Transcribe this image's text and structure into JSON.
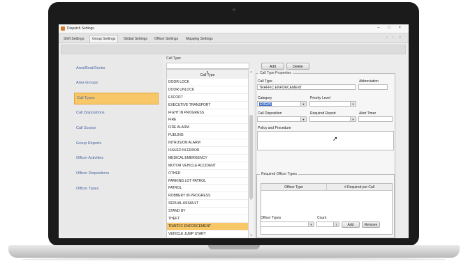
{
  "window": {
    "title": "Dispatch Settings",
    "controls": "–  □  ×"
  },
  "tabs": [
    "Shift Settings",
    "Group Settings",
    "Global Settings",
    "Officer Settings",
    "Mapping Settings"
  ],
  "tab_nav": "‹  ›  ×",
  "sidebar": {
    "items": [
      "Area/Beat/Sector",
      "Area Groups",
      "Call Types",
      "Call Dispositions",
      "Call Source",
      "Group Reports",
      "Officer Activities",
      "Officer Dispositions",
      "Officer Types"
    ],
    "selected": "Call Types"
  },
  "call_type_list": {
    "caption": "Call Type",
    "header": "Call Type",
    "sort_glyph": "▲",
    "items": [
      "DOOR LOCK",
      "DOOR UNLOCK",
      "ESCORT",
      "EXECUTIVE TRANSPORT",
      "FIGHT IN PROGRESS",
      "FIRE",
      "FIRE ALARM",
      "FUELING",
      "INTRUSION ALARM",
      "ISSUED IN ERROR",
      "MEDICAL EMERGENCY",
      "MOTOR VEHICLE ACCIDENT",
      "OTHER",
      "PARKING LOT PATROL",
      "PATROL",
      "ROBBERY IN PROGRESS",
      "SEXUAL ASSAULT",
      "STAND BY",
      "THEFT",
      "TRAFFIC ENFORCEMENT",
      "VEHICLE JUMP START"
    ],
    "selected": "TRAFFIC ENFORCEMENT"
  },
  "buttons": {
    "add": "Add",
    "delete": "Delete"
  },
  "properties": {
    "legend": "Call Type Properties",
    "call_type_label": "Call Type",
    "call_type_value": "TRAFFIC ENFORCEMENT",
    "abbreviation_label": "Abbreviation",
    "abbreviation_value": "",
    "category_label": "Category",
    "category_value": "ENGIN",
    "priority_label": "Priority Level",
    "priority_value": "",
    "disposition_label": "Call Disposition",
    "disposition_value": "",
    "required_report_label": "Required Report",
    "required_report_value": "",
    "alert_timer_label": "Alert Timer",
    "alert_timer_value": "",
    "policy_label": "Policy and Procedure"
  },
  "required_officers": {
    "legend": "Required Officer Types",
    "col_officer_type": "Officer Type",
    "col_required": "# Required per Call",
    "officer_types_label": "Officer Types",
    "count_label": "Count",
    "add_label": "Add",
    "remove_label": "Remove"
  },
  "icons": {
    "combo": "chevron-down-icon",
    "sort": "sort-up-icon",
    "cursor": "mouse-cursor-icon",
    "app": "app-icon"
  },
  "colors": {
    "selection": "#f7c768",
    "sidebar_text": "#4a67a3",
    "text_highlight": "#3f6fc6"
  }
}
